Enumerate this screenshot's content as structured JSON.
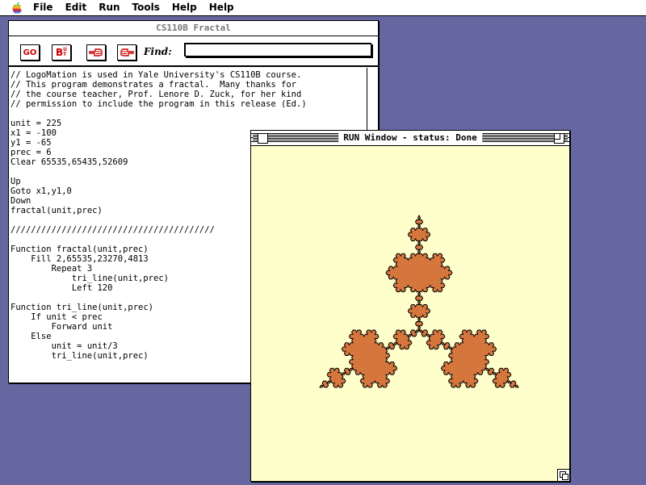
{
  "menubar": {
    "items": [
      "File",
      "Edit",
      "Run",
      "Tools",
      "Help",
      "Help"
    ]
  },
  "editor": {
    "title": "CS110B Fractal",
    "toolbar": {
      "go_label": "GO",
      "bu_label": "B",
      "bu_sup": "U",
      "bu_sub": "T",
      "find_label": "Find:",
      "find_value": ""
    },
    "code": "// LogoMation is used in Yale University's CS110B course.\n// This program demonstrates a fractal.  Many thanks for\n// the course teacher, Prof. Lenore D. Zuck, for her kind\n// permission to include the program in this release (Ed.)\n\nunit = 225\nx1 = -100\ny1 = -65\nprec = 6\nClear 65535,65435,52609\n\nUp\nGoto x1,y1,0\nDown\nfractal(unit,prec)\n\n////////////////////////////////////////\n\nFunction fractal(unit,prec)\n    Fill 2,65535,23270,4813\n        Repeat 3\n            tri_line(unit,prec)\n            Left 120\n\nFunction tri_line(unit,prec)\n    If unit < prec\n        Forward unit\n    Else\n        unit = unit/3\n        tri_line(unit,prec)"
  },
  "run_window": {
    "title": "RUN Window - status: Done",
    "background": "#ffffcc",
    "fill_color": "#d97a40",
    "stroke_color": "#000000"
  },
  "icons": {
    "apple": "apple-logo-icon",
    "hand_left": "pointing-hand-left-icon",
    "hand_right": "pointing-hand-right-icon"
  }
}
